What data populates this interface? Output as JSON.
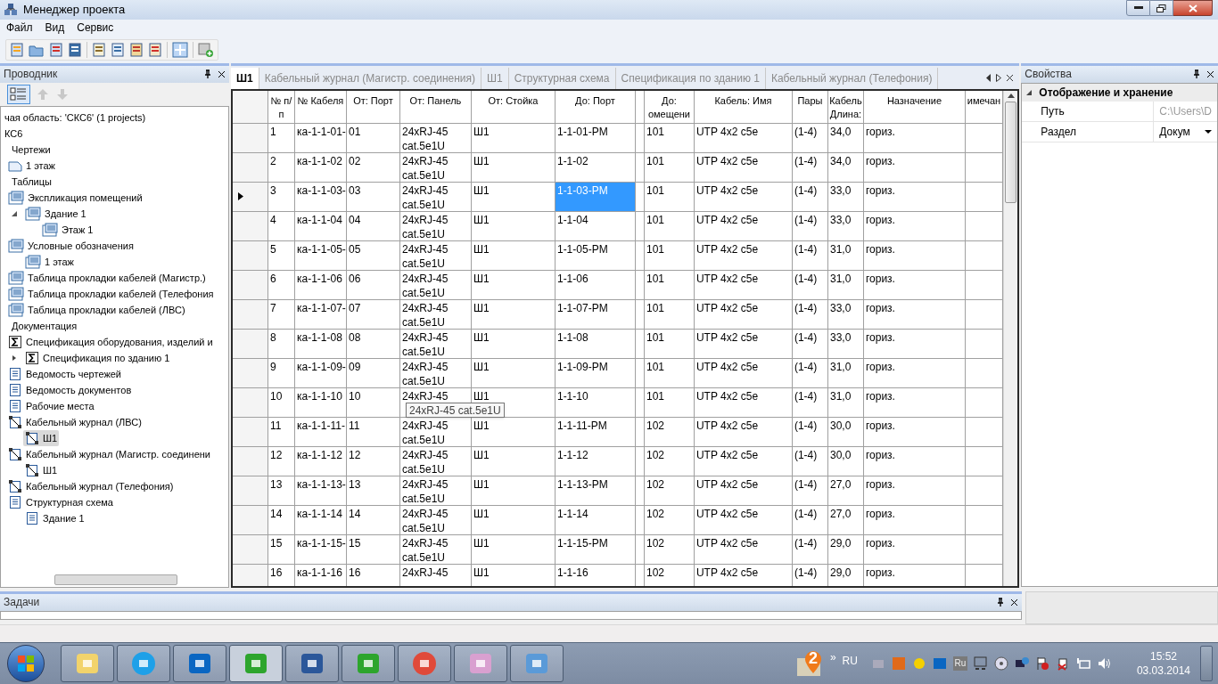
{
  "window": {
    "title": "Менеджер проекта"
  },
  "menu": [
    "Файл",
    "Вид",
    "Сервис"
  ],
  "explorer": {
    "title": "Проводник",
    "tree": [
      {
        "label": "чая область: 'СКС6' (1 projects)",
        "kind": "plain"
      },
      {
        "label": "КС6",
        "kind": "plain"
      },
      {
        "label": "Чертежи",
        "kind": "group",
        "children": [
          {
            "label": "1 этаж",
            "kind": "drawing",
            "selected": false
          }
        ]
      },
      {
        "label": "Таблицы",
        "kind": "group",
        "children": [
          {
            "label": "Экспликация помещений",
            "kind": "table",
            "selected": false,
            "children": [
              {
                "label": "Здание 1",
                "kind": "table",
                "selected": false,
                "expanded": true,
                "children": [
                  {
                    "label": "Этаж 1",
                    "kind": "table",
                    "selected": false
                  }
                ]
              }
            ]
          },
          {
            "label": "Условные обозначения",
            "kind": "table",
            "selected": false,
            "children": [
              {
                "label": "1 этаж",
                "kind": "table",
                "selected": false
              }
            ]
          },
          {
            "label": "Таблица прокладки кабелей (Магистр.)",
            "kind": "table",
            "selected": false
          },
          {
            "label": "Таблица прокладки кабелей (Телефония",
            "kind": "table",
            "selected": false
          },
          {
            "label": "Таблица прокладки кабелей (ЛВС)",
            "kind": "table",
            "selected": false
          }
        ]
      },
      {
        "label": "Документация",
        "kind": "group",
        "children": [
          {
            "label": "Спецификация оборудования, изделий и",
            "kind": "spec",
            "selected": false,
            "children": [
              {
                "label": "Спецификация по зданию 1",
                "kind": "spec",
                "selected": false,
                "expanded": false
              }
            ]
          },
          {
            "label": "Ведомость чертежей",
            "kind": "doc",
            "selected": false
          },
          {
            "label": "Ведомость документов",
            "kind": "doc",
            "selected": false
          },
          {
            "label": "Рабочие места",
            "kind": "doc",
            "selected": false
          },
          {
            "label": "Кабельный журнал (ЛВС)",
            "kind": "journal",
            "selected": false,
            "children": [
              {
                "label": "Ш1",
                "kind": "journal",
                "selected": true
              }
            ]
          },
          {
            "label": "Кабельный журнал (Магистр. соединени",
            "kind": "journal",
            "selected": false,
            "children": [
              {
                "label": "Ш1",
                "kind": "journal",
                "selected": false
              }
            ]
          },
          {
            "label": "Кабельный журнал (Телефония)",
            "kind": "journal",
            "selected": false
          },
          {
            "label": "Структурная схема",
            "kind": "doc",
            "selected": false,
            "children": [
              {
                "label": "Здание 1",
                "kind": "doc",
                "selected": false
              }
            ]
          }
        ]
      }
    ]
  },
  "tabs": [
    {
      "label": "Ш1",
      "selected": true
    },
    {
      "label": "Кабельный журнал (Магистр. соединения)",
      "selected": false
    },
    {
      "label": "Ш1",
      "selected": false
    },
    {
      "label": "Структурная схема",
      "selected": false
    },
    {
      "label": "Спецификация по зданию 1",
      "selected": false
    },
    {
      "label": "Кабельный журнал (Телефония)",
      "selected": false
    }
  ],
  "table": {
    "columns": [
      {
        "label": "№ п/п",
        "selected": false
      },
      {
        "label": "№ Кабеля",
        "selected": false
      },
      {
        "label": "От: Порт",
        "selected": false
      },
      {
        "label": "От: Панель",
        "selected": false
      },
      {
        "label": "От: Стойка",
        "selected": false
      },
      {
        "label": "До: Порт",
        "selected": true
      },
      {
        "label": "До: омещени",
        "selected": false
      },
      {
        "label": "Кабель: Имя",
        "selected": false
      },
      {
        "label": "Пары",
        "selected": false
      },
      {
        "label": "Кабель Длина:",
        "selected": false
      },
      {
        "label": "Назначение",
        "selected": false
      },
      {
        "label": "имечан",
        "selected": false
      }
    ],
    "rows": [
      {
        "selected": false,
        "cells": [
          "1",
          "ка-1-1-01-",
          "01",
          "24xRJ-45 cat.5e1U",
          "Ш1",
          "1-1-01-PM",
          "101",
          "UTP 4x2 c5e",
          "(1-4)",
          "34,0",
          "гориз."
        ]
      },
      {
        "selected": false,
        "cells": [
          "2",
          "ка-1-1-02",
          "02",
          "24xRJ-45 cat.5e1U",
          "Ш1",
          "1-1-02",
          "101",
          "UTP 4x2 c5e",
          "(1-4)",
          "34,0",
          "гориз."
        ]
      },
      {
        "selected": true,
        "cells": [
          "3",
          "ка-1-1-03-",
          "03",
          "24xRJ-45 cat.5e1U",
          "Ш1",
          "1-1-03-PM",
          "101",
          "UTP 4x2 c5e",
          "(1-4)",
          "33,0",
          "гориз."
        ]
      },
      {
        "selected": false,
        "cells": [
          "4",
          "ка-1-1-04",
          "04",
          "24xRJ-45 cat.5e1U",
          "Ш1",
          "1-1-04",
          "101",
          "UTP 4x2 c5e",
          "(1-4)",
          "33,0",
          "гориз."
        ]
      },
      {
        "selected": false,
        "cells": [
          "5",
          "ка-1-1-05-",
          "05",
          "24xRJ-45 cat.5e1U",
          "Ш1",
          "1-1-05-PM",
          "101",
          "UTP 4x2 c5e",
          "(1-4)",
          "31,0",
          "гориз."
        ]
      },
      {
        "selected": false,
        "cells": [
          "6",
          "ка-1-1-06",
          "06",
          "24xRJ-45 cat.5e1U",
          "Ш1",
          "1-1-06",
          "101",
          "UTP 4x2 c5e",
          "(1-4)",
          "31,0",
          "гориз."
        ]
      },
      {
        "selected": false,
        "cells": [
          "7",
          "ка-1-1-07-",
          "07",
          "24xRJ-45 cat.5e1U",
          "Ш1",
          "1-1-07-PM",
          "101",
          "UTP 4x2 c5e",
          "(1-4)",
          "33,0",
          "гориз."
        ]
      },
      {
        "selected": false,
        "cells": [
          "8",
          "ка-1-1-08",
          "08",
          "24xRJ-45 cat.5e1U",
          "Ш1",
          "1-1-08",
          "101",
          "UTP 4x2 c5e",
          "(1-4)",
          "33,0",
          "гориз."
        ]
      },
      {
        "selected": false,
        "cells": [
          "9",
          "ка-1-1-09-",
          "09",
          "24xRJ-45 cat.5e1U",
          "Ш1",
          "1-1-09-PM",
          "101",
          "UTP 4x2 c5e",
          "(1-4)",
          "31,0",
          "гориз."
        ]
      },
      {
        "selected": false,
        "cells": [
          "10",
          "ка-1-1-10",
          "10",
          "24xRJ-45",
          "Ш1",
          "1-1-10",
          "101",
          "UTP 4x2 c5e",
          "(1-4)",
          "31,0",
          "гориз."
        ]
      },
      {
        "selected": false,
        "cells": [
          "11",
          "ка-1-1-11-",
          "11",
          "24xRJ-45 cat.5e1U",
          "Ш1",
          "1-1-11-PM",
          "102",
          "UTP 4x2 c5e",
          "(1-4)",
          "30,0",
          "гориз."
        ]
      },
      {
        "selected": false,
        "cells": [
          "12",
          "ка-1-1-12",
          "12",
          "24xRJ-45 cat.5e1U",
          "Ш1",
          "1-1-12",
          "102",
          "UTP 4x2 c5e",
          "(1-4)",
          "30,0",
          "гориз."
        ]
      },
      {
        "selected": false,
        "cells": [
          "13",
          "ка-1-1-13-",
          "13",
          "24xRJ-45 cat.5e1U",
          "Ш1",
          "1-1-13-PM",
          "102",
          "UTP 4x2 c5e",
          "(1-4)",
          "27,0",
          "гориз."
        ]
      },
      {
        "selected": false,
        "cells": [
          "14",
          "ка-1-1-14",
          "14",
          "24xRJ-45 cat.5e1U",
          "Ш1",
          "1-1-14",
          "102",
          "UTP 4x2 c5e",
          "(1-4)",
          "27,0",
          "гориз."
        ]
      },
      {
        "selected": false,
        "cells": [
          "15",
          "ка-1-1-15-",
          "15",
          "24xRJ-45 cat.5e1U",
          "Ш1",
          "1-1-15-PM",
          "102",
          "UTP 4x2 c5e",
          "(1-4)",
          "29,0",
          "гориз."
        ]
      },
      {
        "selected": false,
        "cells": [
          "16",
          "ка-1-1-16",
          "16",
          "24xRJ-45",
          "Ш1",
          "1-1-16",
          "102",
          "UTP 4x2 c5e",
          "(1-4)",
          "29,0",
          "гориз."
        ]
      }
    ],
    "tooltip": "24xRJ-45 cat.5e1U"
  },
  "properties": {
    "title": "Свойства",
    "group": {
      "label": "Отображение и хранение",
      "expanded": true
    },
    "rows": [
      {
        "name": "Путь",
        "value": "C:\\Users\\D",
        "disabled": true,
        "kind": "text"
      },
      {
        "name": "Раздел",
        "value": "Докум",
        "disabled": false,
        "kind": "dropdown"
      }
    ]
  },
  "tasks": {
    "title": "Задачи"
  },
  "taskbar": {
    "tray_badge": "2",
    "overflow": "»",
    "language": "RU",
    "tray_label": "Ru",
    "time": "15:52",
    "date": "03.03.2014"
  }
}
